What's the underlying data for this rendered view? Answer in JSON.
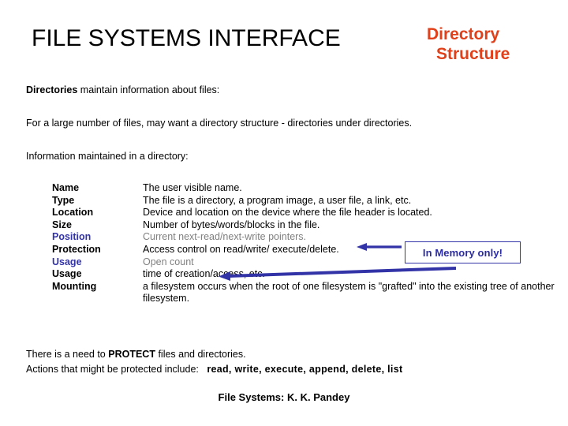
{
  "slide": {
    "main_title": "FILE SYSTEMS INTERFACE",
    "subject_title_line1": "Directory",
    "subject_title_line2": "Structure",
    "accent_color": "#E0401A",
    "highlight_color": "#3333A8",
    "muted_color": "#808080"
  },
  "intro": {
    "directories_bold": "Directories",
    "directories_rest": " maintain information about files:",
    "large_number": "For a large number of files, may want a directory structure - directories under directories.",
    "info_maintained": "Information maintained in a directory:"
  },
  "attributes": [
    {
      "name": "Name",
      "name_color": "black",
      "desc": "The user visible name.",
      "desc_color": "black"
    },
    {
      "name": "Type",
      "name_color": "black",
      "desc": "The file is a directory, a program image, a user file, a link, etc.",
      "desc_color": "black"
    },
    {
      "name": "Location",
      "name_color": "black",
      "desc": "Device and location on the device where the file header is located.",
      "desc_color": "black"
    },
    {
      "name": "Size",
      "name_color": "black",
      "desc": "Number of bytes/words/blocks in the file.",
      "desc_color": "black"
    },
    {
      "name": "Position",
      "name_color": "blue",
      "desc": "Current next-read/next-write pointers.",
      "desc_color": "gray"
    },
    {
      "name": "Protection",
      "name_color": "black",
      "desc": "Access control on read/write/ execute/delete.",
      "desc_color": "black"
    },
    {
      "name": "Usage",
      "name_color": "blue",
      "desc": "Open count",
      "desc_color": "gray"
    },
    {
      "name": "Usage",
      "name_color": "black",
      "desc": "time of creation/access, etc.",
      "desc_color": "black"
    },
    {
      "name": "Mounting",
      "name_color": "black",
      "desc": "a filesystem occurs when the root of one filesystem is \"grafted\" into the existing tree of another filesystem.",
      "desc_color": "black"
    }
  ],
  "callout": {
    "label": "In Memory only!"
  },
  "footer": {
    "protect_prefix": "There is a need to ",
    "protect_bold": "PROTECT",
    "protect_suffix": " files and directories.",
    "actions_prefix": "Actions that might be protected include:",
    "actions_list": "read,  write,  execute,  append,  delete,  list",
    "credit": "File Systems: K. K. Pandey"
  }
}
